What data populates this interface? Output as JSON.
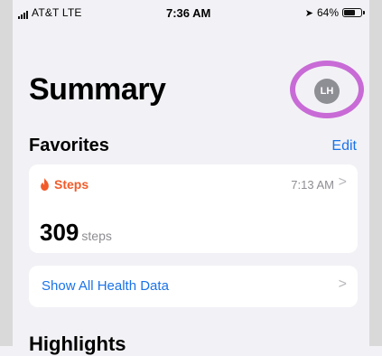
{
  "status_bar": {
    "carrier": "AT&T  LTE",
    "time": "7:36 AM",
    "battery_percent": "64%",
    "battery_level": 0.64,
    "signal_icon": "signal-bars-icon",
    "location_icon": "location-arrow-icon",
    "battery_icon": "battery-icon"
  },
  "header": {
    "title": "Summary",
    "avatar_initials": "LH",
    "annotation_color": "#c86bd6"
  },
  "favorites": {
    "title": "Favorites",
    "edit_label": "Edit",
    "card": {
      "label": "Steps",
      "time": "7:13 AM",
      "value": "309",
      "unit": "steps",
      "accent_color": "#f25c2a",
      "icon": "flame-icon"
    },
    "show_all_label": "Show All Health Data"
  },
  "highlights": {
    "title": "Highlights"
  },
  "colors": {
    "link": "#1a73e8",
    "background": "#f2f2f6"
  }
}
